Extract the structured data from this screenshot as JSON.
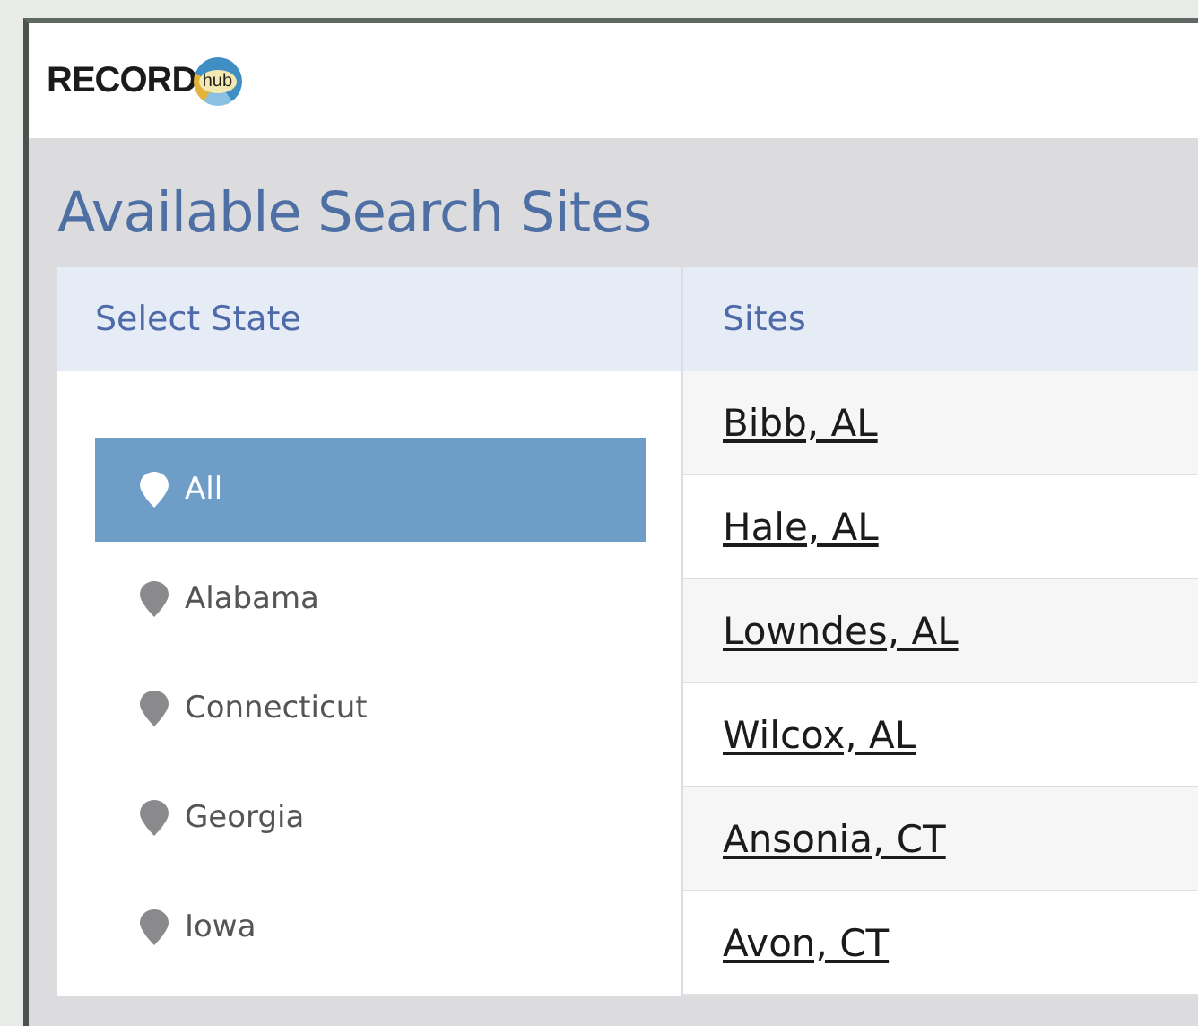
{
  "logo": {
    "text": "RECORD",
    "badge": "hub"
  },
  "page_title": "Available Search Sites",
  "columns": [
    "Select State",
    "Sites"
  ],
  "states": [
    {
      "label": "All",
      "selected": true
    },
    {
      "label": "Alabama",
      "selected": false
    },
    {
      "label": "Connecticut",
      "selected": false
    },
    {
      "label": "Georgia",
      "selected": false
    },
    {
      "label": "Iowa",
      "selected": false
    }
  ],
  "sites": [
    "Bibb, AL",
    "Hale, AL",
    "Lowndes, AL",
    "Wilcox, AL",
    "Ansonia, CT",
    "Avon, CT"
  ]
}
